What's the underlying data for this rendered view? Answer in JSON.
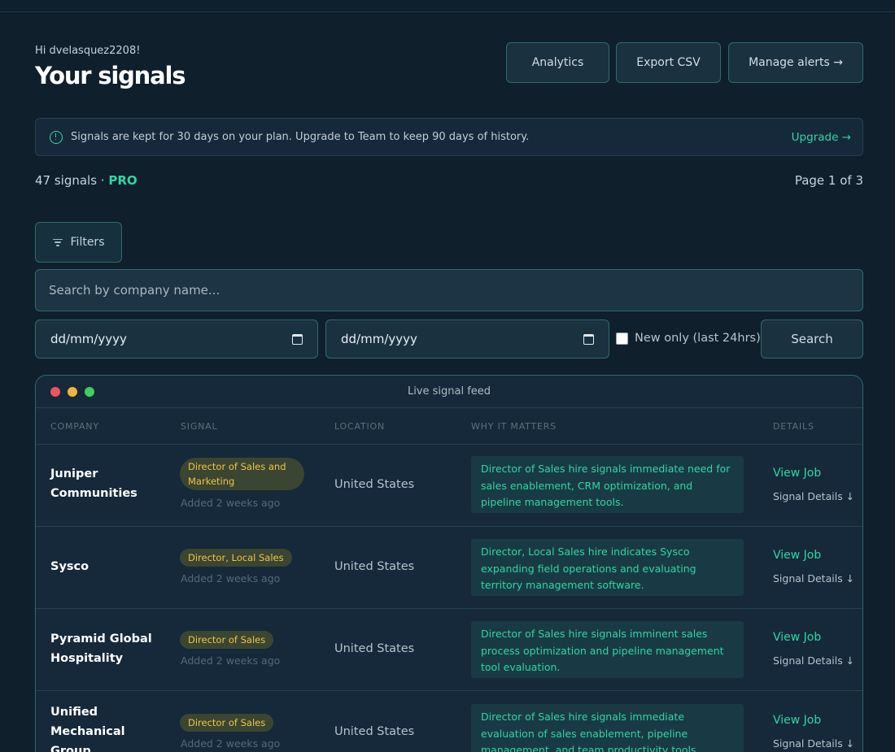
{
  "header": {
    "greeting": "Hi dvelasquez2208!",
    "title": "Your signals",
    "buttons": {
      "analytics": "Analytics",
      "export": "Export CSV",
      "manage": "Manage alerts →"
    }
  },
  "notice": {
    "text": "Signals are kept for 30 days on your plan. Upgrade to Team to keep 90 days of history.",
    "upgrade": "Upgrade →",
    "icon": "info-icon"
  },
  "summary": {
    "count": "47 signals · ",
    "plan": "PRO",
    "page": "Page 1 of 3"
  },
  "filters": {
    "label": "Filters",
    "icon": "filter-icon"
  },
  "search": {
    "placeholder": "Search by company name...",
    "date_from": "dd/mm/yyyy",
    "date_to": "dd/mm/yyyy",
    "new_only_label": "New only (last 24hrs)",
    "button": "Search"
  },
  "feed": {
    "title": "Live signal feed",
    "columns": {
      "company": "COMPANY",
      "signal": "SIGNAL",
      "location": "LOCATION",
      "why": "WHY IT MATTERS",
      "details": "DETAILS"
    },
    "rows": [
      {
        "company": "Juniper Communities",
        "signal": "Director of Sales and Marketing",
        "added": "Added 2 weeks ago",
        "location": "United States",
        "why": "Director of Sales hire signals immediate need for sales enablement, CRM optimization, and pipeline management tools.",
        "view": "View Job",
        "details": "Signal Details ↓"
      },
      {
        "company": "Sysco",
        "signal": "Director, Local Sales",
        "added": "Added 2 weeks ago",
        "location": "United States",
        "why": "Director, Local Sales hire indicates Sysco expanding field operations and evaluating territory management software.",
        "view": "View Job",
        "details": "Signal Details ↓"
      },
      {
        "company": "Pyramid Global Hospitality",
        "signal": "Director of Sales",
        "added": "Added 2 weeks ago",
        "location": "United States",
        "why": "Director of Sales hire signals imminent sales process optimization and pipeline management tool evaluation.",
        "view": "View Job",
        "details": "Signal Details ↓"
      },
      {
        "company": "Unified Mechanical Group",
        "signal": "Director of Sales",
        "added": "Added 2 weeks ago",
        "location": "United States",
        "why": "Director of Sales hire signals immediate evaluation of sales enablement, pipeline management, and team productivity tools.",
        "view": "View Job",
        "details": "Signal Details ↓"
      }
    ]
  },
  "colors": {
    "background": "#0f1f2c",
    "accent": "#2fd6a3",
    "pill_text": "#f2c347",
    "border": "#2f6b6c"
  }
}
